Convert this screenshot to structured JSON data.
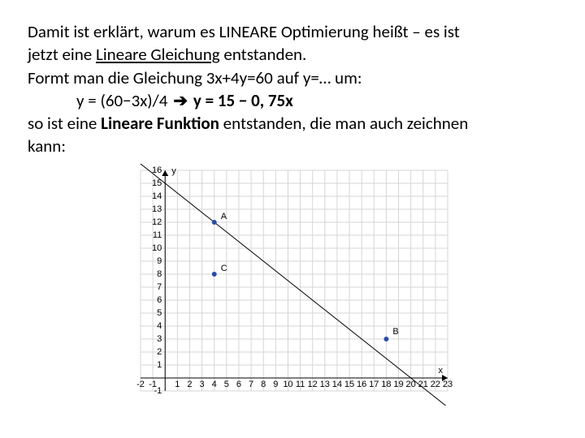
{
  "text": {
    "p1a": "Damit ist erklärt, warum es LINEARE Optimierung heißt – es ist",
    "p1b": "jetzt eine ",
    "p1c_u": "Lineare Gleichung",
    "p1d": " entstanden.",
    "p2": "Formt man die Gleichung     3x+4y=60   auf  y=…   um:",
    "p3a": "y = (60−3x)/4      ",
    "p3b": "   y =  15 − 0, 75x",
    "p4a": "so ist eine ",
    "p4b_b": "Lineare Funktion",
    "p4c": " entstanden, die man auch zeichnen",
    "p4d": "kann:"
  },
  "chart_data": {
    "type": "line",
    "title": "",
    "xlabel": "x",
    "ylabel": "y",
    "xlim": [
      -2,
      23
    ],
    "ylim": [
      -1,
      16
    ],
    "x_ticks": [
      -2,
      -1,
      1,
      2,
      3,
      4,
      5,
      6,
      7,
      8,
      9,
      10,
      11,
      12,
      13,
      14,
      15,
      16,
      17,
      18,
      19,
      20,
      21,
      22,
      23
    ],
    "y_ticks": [
      -1,
      1,
      2,
      3,
      4,
      5,
      6,
      7,
      8,
      9,
      10,
      11,
      12,
      13,
      14,
      15,
      16
    ],
    "line": {
      "slope": -0.75,
      "intercept": 15
    },
    "points": [
      {
        "name": "A",
        "x": 4,
        "y": 12
      },
      {
        "name": "C",
        "x": 4,
        "y": 8
      },
      {
        "name": "B",
        "x": 18,
        "y": 3
      }
    ]
  }
}
